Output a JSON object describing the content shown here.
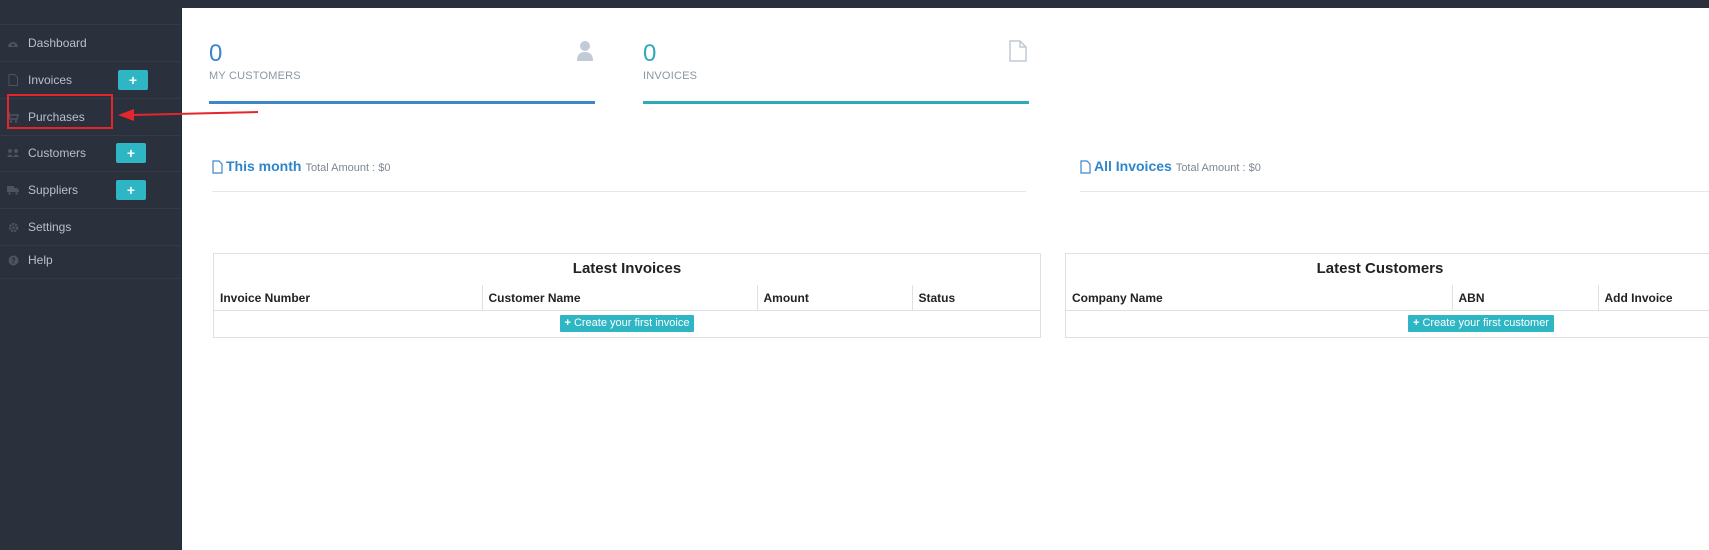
{
  "sidebar": {
    "items": [
      {
        "label": "Dashboard",
        "icon": "dashboard-icon"
      },
      {
        "label": "Invoices",
        "icon": "file-icon",
        "add": "+"
      },
      {
        "label": "Purchases",
        "icon": "cart-icon"
      },
      {
        "label": "Customers",
        "icon": "users-icon",
        "add": "+"
      },
      {
        "label": "Suppliers",
        "icon": "truck-icon",
        "add": "+"
      },
      {
        "label": "Settings",
        "icon": "gear-icon"
      },
      {
        "label": "Help",
        "icon": "question-icon"
      }
    ]
  },
  "stats": {
    "customers": {
      "value": "0",
      "label": "MY CUSTOMERS",
      "icon": "user-icon",
      "color": "#3c87c9"
    },
    "invoices": {
      "value": "0",
      "label": "INVOICES",
      "icon": "file-icon",
      "color": "#2fa9b8"
    }
  },
  "summary": {
    "month": {
      "title": "This month",
      "amount": "Total Amount : $0"
    },
    "all": {
      "title": "All Invoices",
      "amount": "Total Amount : $0"
    }
  },
  "latest_invoices": {
    "title": "Latest Invoices",
    "columns": [
      "Invoice Number",
      "Customer Name",
      "Amount",
      "Status"
    ],
    "empty_button": "Create your first invoice"
  },
  "latest_customers": {
    "title": "Latest Customers",
    "columns": [
      "Company Name",
      "ABN",
      "Add Invoice"
    ],
    "empty_button": "Create your first customer"
  },
  "colors": {
    "sidebar_bg": "#2a313d",
    "accent_teal": "#2fb6c4",
    "accent_blue": "#3c87c9",
    "annotation_red": "#e3262b"
  }
}
